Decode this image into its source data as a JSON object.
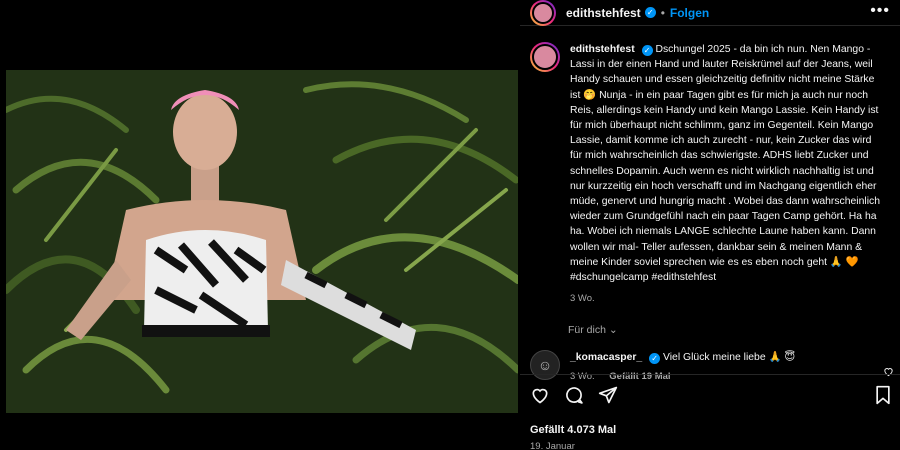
{
  "post": {
    "username": "edithstehfest",
    "follow_label": "Folgen",
    "more_label": "•••",
    "caption_text": "Dschungel 2025 - da bin ich nun. Nen Mango - Lassi in der einen Hand und lauter Reiskrümel auf der Jeans, weil Handy schauen und essen gleichzeitig definitiv nicht meine Stärke ist 🤭 Nunja - in ein paar Tagen gibt es für mich ja auch nur noch Reis, allerdings kein Handy und kein Mango Lassie. Kein Handy ist für mich überhaupt nicht schlimm, ganz im Gegenteil. Kein Mango Lassie, damit komme ich auch zurecht - nur, kein Zucker das wird für mich wahrscheinlich das schwierigste. ADHS liebt Zucker und schnelles Dopamin. Auch wenn es nicht wirklich nachhaltig ist und nur kurzzeitig ein hoch verschafft und im Nachgang eigentlich eher müde, genervt und hungrig macht . Wobei das dann wahrscheinlich wieder zum Grundgefühl nach ein paar Tagen Camp gehört. Ha ha ha. Wobei ich niemals LANGE schlechte Laune haben kann. Dann wollen wir mal- Teller aufessen, dankbar sein & meinen Mann & meine Kinder soviel sprechen wie es es eben noch geht 🙏 🧡 #dschungelcamp #edithstehfest",
    "caption_time": "3 Wo.",
    "translate_label": "Für dich ⌄",
    "likes": "Gefällt 4.073 Mal",
    "date": "19. Januar"
  },
  "comment": {
    "username": "_komacasper_",
    "text": "Viel Glück meine liebe 🙏 😇",
    "time": "3 Wo.",
    "likes": "Gefällt 19 Mal"
  },
  "icons": {
    "verified": "verified-badge-icon",
    "like": "heart-icon",
    "comment": "comment-icon",
    "share": "share-icon",
    "save": "bookmark-icon"
  },
  "colors": {
    "background": "#000000",
    "link": "#0095f6",
    "muted": "#a8a8a8"
  }
}
